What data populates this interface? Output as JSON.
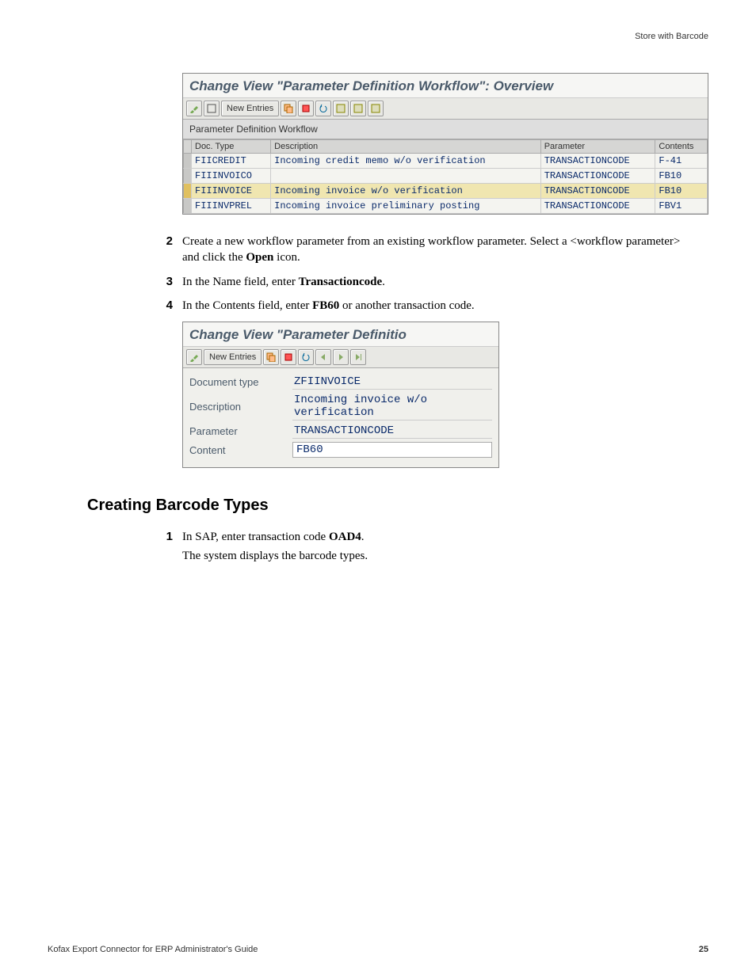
{
  "header": {
    "breadcrumb": "Store with Barcode"
  },
  "screenshot1": {
    "title": "Change View \"Parameter Definition Workflow\": Overview",
    "new_entries_label": "New Entries",
    "subheader": "Parameter Definition Workflow",
    "columns": [
      "Doc. Type",
      "Description",
      "Parameter",
      "Contents"
    ],
    "rows": [
      {
        "doc_type": "FIICREDIT",
        "description": "Incoming credit memo w/o verification",
        "parameter": "TRANSACTIONCODE",
        "contents": "F-41",
        "selected": false
      },
      {
        "doc_type": "FIIINVOICO",
        "description": "",
        "parameter": "TRANSACTIONCODE",
        "contents": "FB10",
        "selected": false
      },
      {
        "doc_type": "FIIINVOICE",
        "description": "Incoming invoice w/o verification",
        "parameter": "TRANSACTIONCODE",
        "contents": "FB10",
        "selected": true
      },
      {
        "doc_type": "FIIINVPREL",
        "description": "Incoming invoice preliminary posting",
        "parameter": "TRANSACTIONCODE",
        "contents": "FBV1",
        "selected": false
      }
    ]
  },
  "steps_a": [
    {
      "num": "2",
      "body": "Create a new workflow parameter from an existing workflow parameter. Select a <workflow parameter> and click the ",
      "bold": "Open",
      "body2": " icon."
    },
    {
      "num": "3",
      "body": "In the Name field, enter  ",
      "bold": "Transactioncode",
      "body2": "."
    },
    {
      "num": "4",
      "body": "In the Contents field, enter  ",
      "bold": "FB60",
      "body2": " or another transaction code."
    }
  ],
  "screenshot2": {
    "title": "Change View \"Parameter Definitio",
    "new_entries_label": "New Entries",
    "fields": [
      {
        "label": "Document type",
        "value": "ZFIINVOICE",
        "input": false
      },
      {
        "label": "Description",
        "value": "Incoming invoice w/o verification",
        "input": false
      },
      {
        "label": "Parameter",
        "value": "TRANSACTIONCODE",
        "input": false
      },
      {
        "label": "Content",
        "value": "FB60",
        "input": true
      }
    ]
  },
  "section_heading": "Creating Barcode Types",
  "steps_b": [
    {
      "num": "1",
      "body": "In SAP, enter transaction code ",
      "bold": "OAD4",
      "body2": ".",
      "sub": "The system displays the barcode types."
    }
  ],
  "footer": {
    "left": "Kofax Export Connector for ERP Administrator's Guide",
    "page": "25"
  }
}
